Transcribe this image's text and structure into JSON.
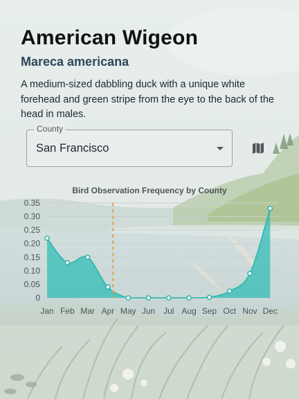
{
  "species": {
    "common_name": "American Wigeon",
    "scientific_name": "Mareca americana",
    "description": "A medium-sized dabbling duck with a unique white forehead and green stripe from the eye to the back of the head in males."
  },
  "county_select": {
    "label": "County",
    "value": "San Francisco"
  },
  "map_button": {
    "icon": "map-icon"
  },
  "chart_data": {
    "type": "area",
    "title": "Bird Observation Frequency by County",
    "categories": [
      "Jan",
      "Feb",
      "Mar",
      "Apr",
      "May",
      "Jun",
      "Jul",
      "Aug",
      "Sep",
      "Oct",
      "Nov",
      "Dec"
    ],
    "values": [
      0.22,
      0.13,
      0.15,
      0.04,
      0.0,
      0.0,
      0.0,
      0.0,
      0.002,
      0.025,
      0.09,
      0.33
    ],
    "y_ticks": [
      "0",
      "0.05",
      "0.10",
      "0.15",
      "0.20",
      "0.25",
      "0.30",
      "0.35"
    ],
    "ylim": [
      0,
      0.35
    ],
    "grid": true,
    "marker_month": 3.25,
    "colors": {
      "fill": "#2cbcb4",
      "line": "#2bb3ac",
      "marker": "#e2a25a",
      "grid": "#c9cfd0"
    }
  }
}
